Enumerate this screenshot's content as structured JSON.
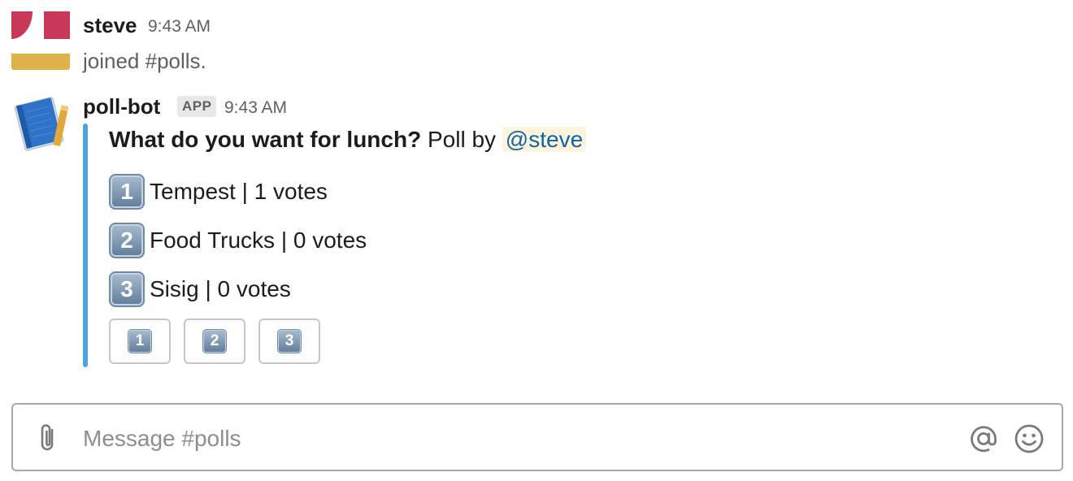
{
  "messages": {
    "steve": {
      "sender": "steve",
      "time": "9:43 AM",
      "text": "joined #polls."
    },
    "pollbot": {
      "sender": "poll-bot",
      "badge": "APP",
      "time": "9:43 AM",
      "poll": {
        "question": "What do you want for lunch?",
        "by_text": "Poll by",
        "mention": "@steve",
        "options": [
          {
            "number": "1",
            "label": "Tempest | 1 votes"
          },
          {
            "number": "2",
            "label": "Food Trucks | 0 votes"
          },
          {
            "number": "3",
            "label": "Sisig | 0 votes"
          }
        ],
        "buttons": [
          "1",
          "2",
          "3"
        ]
      }
    }
  },
  "composer": {
    "placeholder": "Message #polls",
    "value": ""
  },
  "icons": {
    "attach": "paperclip-icon",
    "mention": "at-sign-icon",
    "emoji": "smiley-icon"
  },
  "colors": {
    "attachment_bar": "#4fa3dc",
    "mention_bg": "#fcf4dc",
    "mention_text": "#1264a3",
    "avatar_red": "#c93759",
    "avatar_yellow": "#e0b04a"
  }
}
